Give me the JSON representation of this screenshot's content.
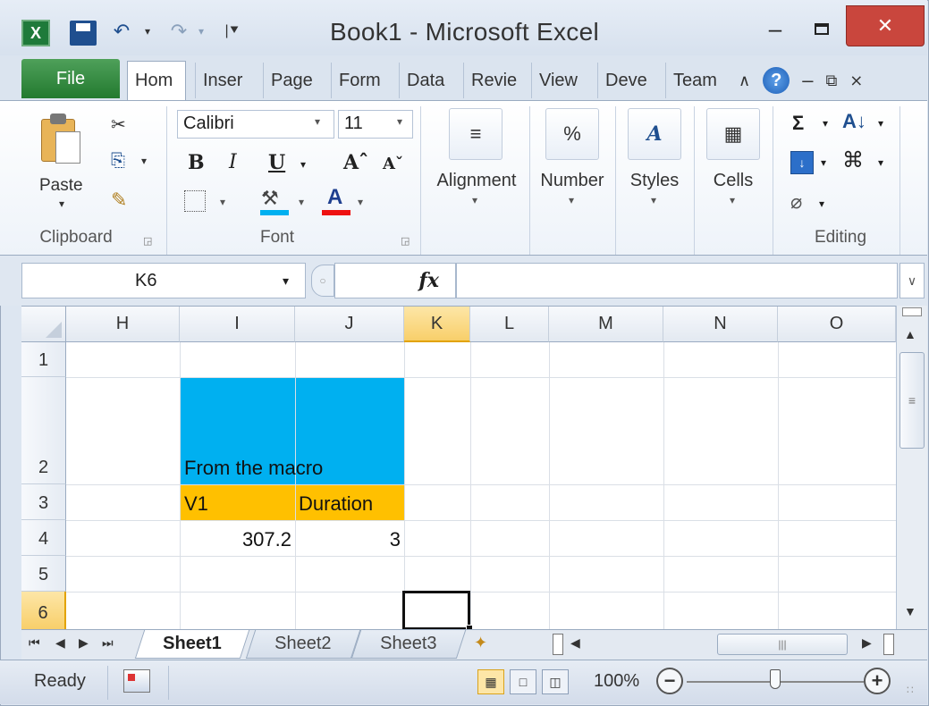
{
  "window": {
    "title": "Book1  -  Microsoft Excel",
    "minimize_glyph": "–",
    "close_glyph": "✕",
    "app_icon_glyph": "X"
  },
  "quick_access": {
    "undo_glyph": "↶",
    "redo_glyph": "↷",
    "dropdown_glyph": "▾",
    "customize_glyph": "|⯆"
  },
  "ribbon_tabs": [
    {
      "label": "File"
    },
    {
      "label": "Hom"
    },
    {
      "label": "Inser"
    },
    {
      "label": "Page"
    },
    {
      "label": "Form"
    },
    {
      "label": "Data"
    },
    {
      "label": "Revie"
    },
    {
      "label": "View"
    },
    {
      "label": "Deve"
    },
    {
      "label": "Team"
    }
  ],
  "tab_icons": {
    "minimize_ribbon_glyph": "∧",
    "help_glyph": "?",
    "restore_glyph": "⧉",
    "close_workbook_glyph": "⨯"
  },
  "clipboard": {
    "paste_label": "Paste",
    "group_label": "Clipboard",
    "cut_glyph": "✂",
    "copy_glyph": "⎘",
    "painter_glyph": "✎"
  },
  "font": {
    "name_value": "Calibri",
    "size_value": "11",
    "bold": "B",
    "italic": "I",
    "underline": "U",
    "grow": "Aˆ",
    "shrink": "Aˇ",
    "fill_glyph": "⚒",
    "color_glyph": "A",
    "group_label": "Font"
  },
  "groups": {
    "alignment": {
      "label": "Alignment",
      "glyph": "≡"
    },
    "number": {
      "label": "Number",
      "glyph": "%"
    },
    "styles": {
      "label": "Styles",
      "glyph": "A"
    },
    "cells": {
      "label": "Cells",
      "glyph": "▦"
    },
    "editing": {
      "label": "Editing",
      "sum_glyph": "Σ",
      "sort_glyph": "A↓",
      "filldown_glyph": "↓",
      "find_glyph": "⌘",
      "clear_glyph": "⌀"
    }
  },
  "launcher_glyph": "◲",
  "dropdown_glyph": "▾",
  "formula_bar": {
    "name_box": "K6",
    "fx_label": "fx",
    "formula_value": "",
    "expand_glyph": "∨"
  },
  "grid": {
    "columns": [
      {
        "label": "H"
      },
      {
        "label": "I"
      },
      {
        "label": "J"
      },
      {
        "label": "K"
      },
      {
        "label": "L"
      },
      {
        "label": "M"
      },
      {
        "label": "N"
      },
      {
        "label": "O"
      }
    ],
    "rows": [
      {
        "label": "1"
      },
      {
        "label": "2"
      },
      {
        "label": "3"
      },
      {
        "label": "4"
      },
      {
        "label": "5"
      },
      {
        "label": "6"
      }
    ],
    "active_column": "K",
    "active_row": "6",
    "cells": {
      "I2": "From the macro",
      "I3": "V1",
      "J3": "Duration",
      "I4": "307.2",
      "J4": "3"
    },
    "fill_colors": {
      "I2_J2": "#00b0f0",
      "I3_J3": "#ffc000"
    }
  },
  "scrollbar": {
    "up_glyph": "▲",
    "down_glyph": "▼",
    "thumb_glyph": "≡",
    "left_glyph": "◀",
    "right_glyph": "▶",
    "hthumb_glyph": "|||"
  },
  "sheet_nav": {
    "first": "⏮",
    "prev": "◀",
    "next": "▶",
    "last": "⏭"
  },
  "sheets": [
    {
      "label": "Sheet1",
      "active": true
    },
    {
      "label": "Sheet2",
      "active": false
    },
    {
      "label": "Sheet3",
      "active": false
    }
  ],
  "new_sheet_glyph": "✦",
  "status_bar": {
    "status": "Ready",
    "zoom": "100%",
    "zoom_out_glyph": "−",
    "zoom_in_glyph": "+",
    "zoom_fraction": 0.5,
    "grip_glyph": "∷"
  }
}
